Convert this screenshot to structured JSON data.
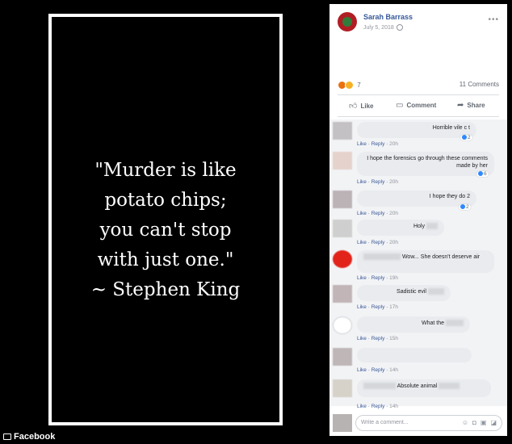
{
  "quote": {
    "lines": [
      "\"Murder is like",
      "potato chips;",
      "you can't stop",
      "with just one.\"",
      "~ Stephen King"
    ]
  },
  "post": {
    "author": "Sarah Barrass",
    "date": "July 5, 2018",
    "reaction_count": "7",
    "comment_count": "11 Comments",
    "actions": {
      "like": "Like",
      "comment": "Comment",
      "share": "Share"
    }
  },
  "comments": [
    {
      "text": "Horrible vile c  t",
      "like": "Like",
      "reply": "Reply",
      "time": "20h",
      "reactions": "2"
    },
    {
      "text": "I hope the forensics go through these comments made by her",
      "like": "Like",
      "reply": "Reply",
      "time": "20h",
      "reactions": "6"
    },
    {
      "text": "I hope they do 2",
      "like": "Like",
      "reply": "Reply",
      "time": "20h",
      "reactions": "2"
    },
    {
      "text": "Holy",
      "like": "Like",
      "reply": "Reply",
      "time": "20h"
    },
    {
      "text": "Wow... She doesn't deserve air",
      "like": "Like",
      "reply": "Reply",
      "time": "19h"
    },
    {
      "text": "Sadistic evil",
      "like": "Like",
      "reply": "Reply",
      "time": "17h"
    },
    {
      "text": "What the",
      "like": "Like",
      "reply": "Reply",
      "time": "15h"
    },
    {
      "text": "",
      "like": "Like",
      "reply": "Reply",
      "time": "14h"
    },
    {
      "text": "Absolute animal",
      "like": "Like",
      "reply": "Reply",
      "time": "14h"
    }
  ],
  "composer": {
    "placeholder": "Write a comment..."
  },
  "attribution": "Facebook",
  "colors": {
    "link": "#365899",
    "frame": "#ffffff",
    "background": "#000000"
  }
}
